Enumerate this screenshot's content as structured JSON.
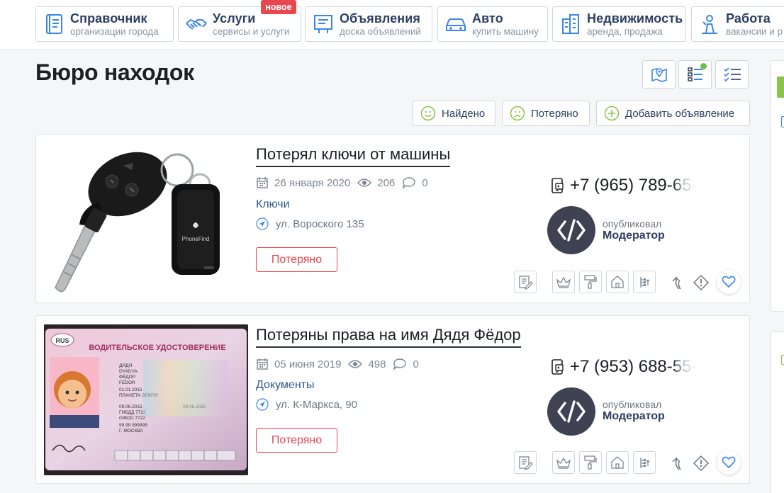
{
  "nav": [
    {
      "title": "Справочник",
      "subtitle": "организации города",
      "icon": "directory-book-icon"
    },
    {
      "title": "Услуги",
      "subtitle": "сервисы и услуги",
      "icon": "handshake-icon",
      "badge": "новое"
    },
    {
      "title": "Объявления",
      "subtitle": "доска объявлений",
      "icon": "billboard-icon"
    },
    {
      "title": "Авто",
      "subtitle": "купить машину",
      "icon": "car-icon"
    },
    {
      "title": "Недвижимость",
      "subtitle": "аренда, продажа",
      "icon": "buildings-icon"
    },
    {
      "title": "Работа",
      "subtitle": "вакансии и р",
      "icon": "worker-icon"
    }
  ],
  "page": {
    "title": "Бюро находок"
  },
  "filters": {
    "found": "Найдено",
    "lost": "Потеряно",
    "add": "Добавить объявление"
  },
  "view_icons": [
    "map-view-icon",
    "list-view-icon",
    "checklist-view-icon"
  ],
  "listings": [
    {
      "title": "Потерял ключи от машины",
      "date": "26 января 2020",
      "views": "206",
      "comments": "0",
      "category": "Ключи",
      "address": "ул. Вороского 135",
      "status": "Потеряно",
      "phone_visible": "+7 (965) 789-",
      "phone_faded": "65-",
      "published_by_label": "опубликовал",
      "author": "Модератор"
    },
    {
      "title": "Потеряны права на имя Дядя Фёдор",
      "date": "05 июня 2019",
      "views": "498",
      "comments": "0",
      "category": "Документы",
      "address": "ул. К-Маркса, 90",
      "status": "Потеряно",
      "phone_visible": "+7 (953) 688-",
      "phone_faded": "55-",
      "published_by_label": "опубликовал",
      "author": "Модератор"
    }
  ],
  "colors": {
    "accent_navy": "#2c3f63",
    "lost_red": "#e8474f",
    "found_green": "#8bc34a",
    "avatar_bg": "#3e4253",
    "heart_blue": "#3a86e8"
  }
}
